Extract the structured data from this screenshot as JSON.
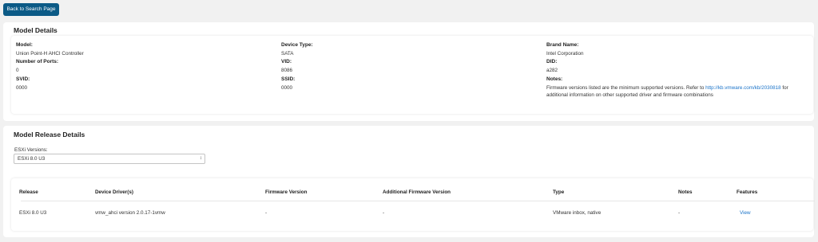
{
  "back_button": {
    "label": "Back to Search Page"
  },
  "model_details": {
    "title": "Model Details",
    "fields": {
      "model": {
        "label": "Model:",
        "value": "Union Point-H AHCI Controller"
      },
      "device_type": {
        "label": "Device Type:",
        "value": "SATA"
      },
      "brand_name": {
        "label": "Brand Name:",
        "value": "Intel Corporation"
      },
      "number_of_ports": {
        "label": "Number of Ports:",
        "value": "0"
      },
      "vid": {
        "label": "VID:",
        "value": "8086"
      },
      "did": {
        "label": "DID:",
        "value": "a282"
      },
      "svid": {
        "label": "SVID:",
        "value": "0000"
      },
      "ssid": {
        "label": "SSID:",
        "value": "0000"
      },
      "notes": {
        "label": "Notes:",
        "text_before": "Firmware versions listed are the minimum supported versions. Refer to ",
        "link": "http://kb.vmware.com/kb/2030818",
        "text_after": " for additional information on other supported driver and firmware combinations"
      }
    }
  },
  "release_details": {
    "title": "Model Release Details",
    "esxi_label": "ESXi Versions:",
    "esxi_selected": "ESXi 8.0 U3",
    "table": {
      "headers": {
        "release": "Release",
        "device_drivers": "Device Driver(s)",
        "firmware_version": "Firmware Version",
        "additional_firmware": "Additional Firmware Version",
        "type": "Type",
        "notes": "Notes",
        "features": "Features"
      },
      "rows": [
        {
          "release": "ESXi 8.0 U3",
          "device_drivers": "vmw_ahci version 2.0.17-1vmw",
          "firmware_version": "-",
          "additional_firmware": "-",
          "type": "VMware inbox, native",
          "notes": "-",
          "features": "View"
        }
      ]
    }
  }
}
